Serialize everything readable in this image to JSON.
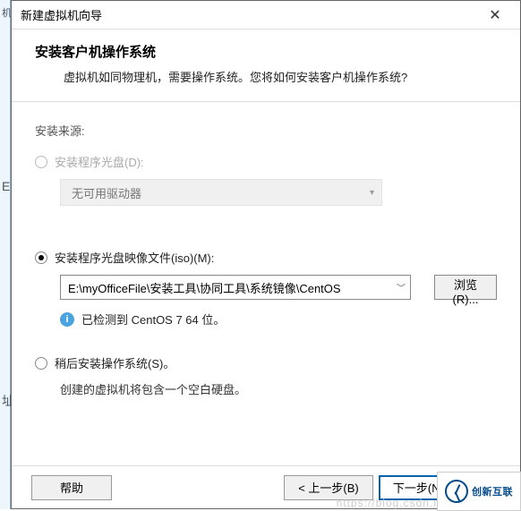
{
  "titlebar": {
    "title": "新建虚拟机向导"
  },
  "header": {
    "title": "安装客户机操作系统",
    "subtitle": "虚拟机如同物理机，需要操作系统。您将如何安装客户机操作系统?"
  },
  "body": {
    "source_label": "安装来源:",
    "opt_disc": {
      "label": "安装程序光盘(D):",
      "drive_text": "无可用驱动器"
    },
    "opt_iso": {
      "label": "安装程序光盘映像文件(iso)(M):",
      "path": "E:\\myOfficeFile\\安装工具\\协同工具\\系统镜像\\CentOS",
      "browse": "浏览(R)...",
      "detected": "已检测到 CentOS 7 64 位。"
    },
    "opt_later": {
      "label": "稍后安装操作系统(S)。",
      "desc": "创建的虚拟机将包含一个空白硬盘。"
    }
  },
  "footer": {
    "help": "帮助",
    "back": "< 上一步(B)",
    "next": "下一步(N) >",
    "cancel_visible": ""
  },
  "logo": {
    "text": "创新互联"
  },
  "left": {
    "l1": "机",
    "l2": "E",
    "l3": "址"
  },
  "watermark": "https://blog.csdn.net/l"
}
